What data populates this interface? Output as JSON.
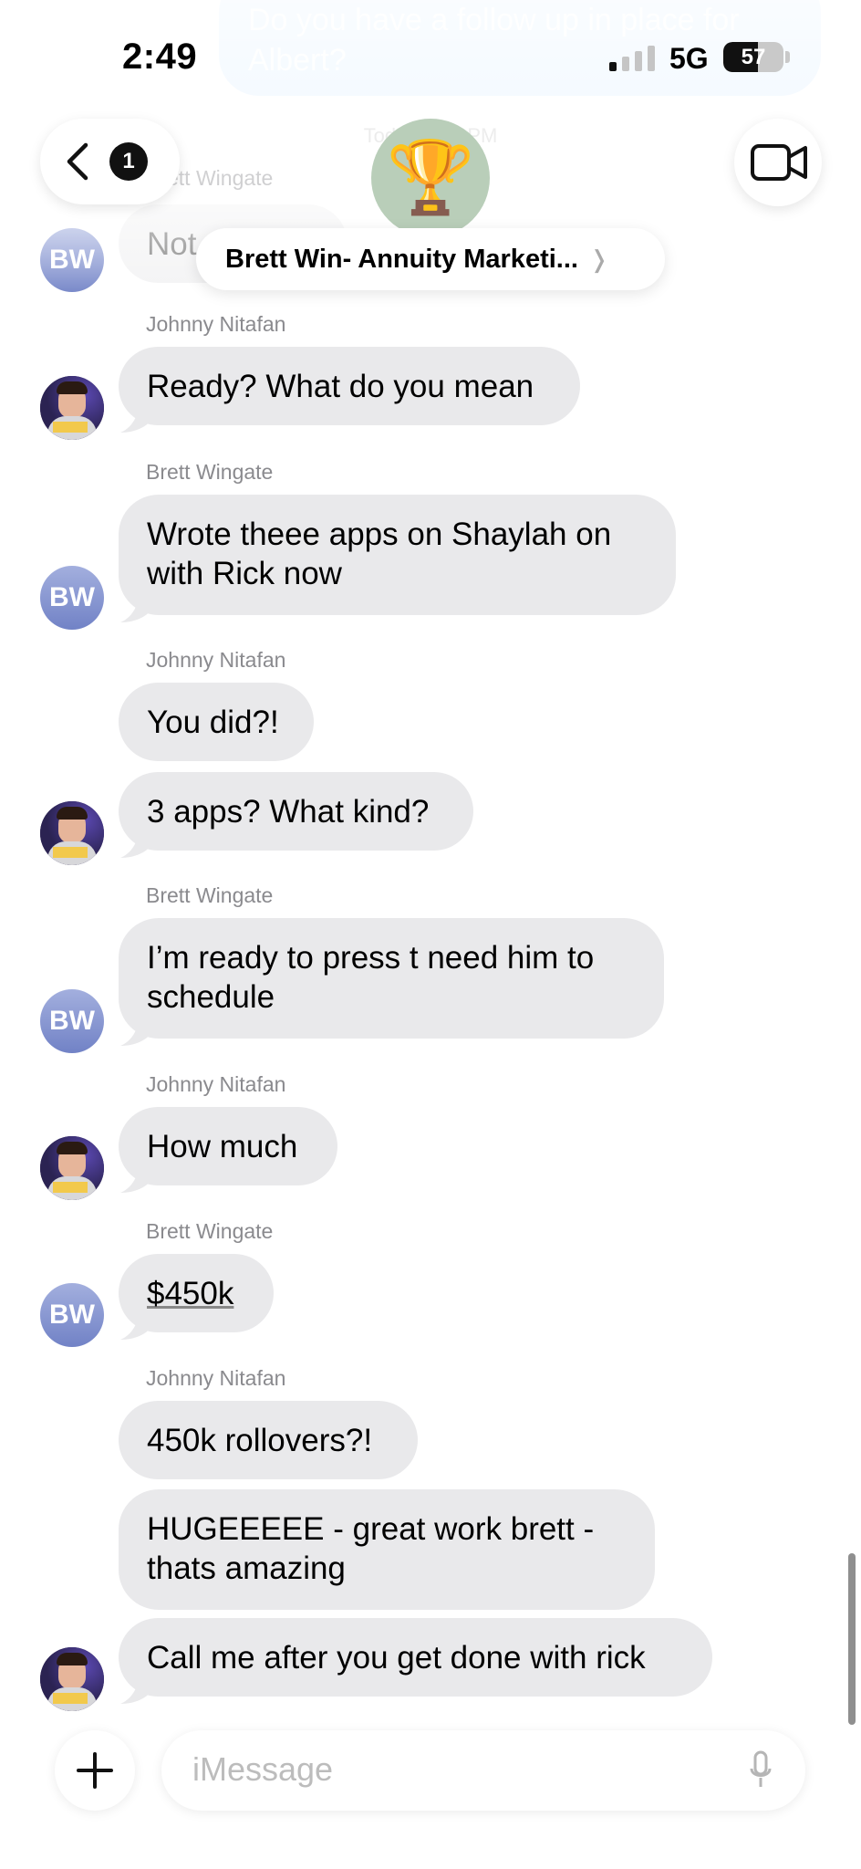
{
  "top_partial_message": {
    "text": "Do you have a follow up in place for Albert?"
  },
  "timestamp": "Today 2:47 PM",
  "status_bar": {
    "time": "2:49",
    "network": "5G",
    "battery_level": "57",
    "battery_fraction": 0.57,
    "signal_bars_active": 1
  },
  "header": {
    "back_badge": "1",
    "group_avatar_emoji": "🏆",
    "group_name": "Brett Win- Annuity Marketi...",
    "group_name_chevron": "❭"
  },
  "conversation": {
    "hidden_top": {
      "sender": "Brett Wingate",
      "text": "Not sure yet"
    },
    "blocks": [
      {
        "sender": "Johnny Nitafan",
        "avatar": "photo",
        "messages": [
          "Ready? What do you mean"
        ]
      },
      {
        "sender": "Brett Wingate",
        "avatar_initials": "BW",
        "messages": [
          "Wrote theee apps on Shaylah on with Rick now"
        ]
      },
      {
        "sender": "Johnny Nitafan",
        "avatar": "photo",
        "messages": [
          "You did?!",
          "3 apps? What kind?"
        ]
      },
      {
        "sender": "Brett Wingate",
        "avatar_initials": "BW",
        "messages": [
          "I’m ready to press t need him to schedule"
        ]
      },
      {
        "sender": "Johnny Nitafan",
        "avatar": "photo",
        "messages": [
          "How much"
        ]
      },
      {
        "sender": "Brett Wingate",
        "avatar_initials": "BW",
        "messages": [
          "$450k"
        ]
      },
      {
        "sender": "Johnny Nitafan",
        "avatar": "photo",
        "messages": [
          "450k rollovers?!",
          "HUGEEEEE - great work brett - thats amazing",
          "Call me after you get done with rick"
        ]
      }
    ]
  },
  "composer": {
    "placeholder": "iMessage",
    "plus_icon": "plus-icon",
    "mic_icon": "microphone-icon"
  },
  "colors": {
    "bubble_incoming": "#e9e9eb",
    "bubble_outgoing_faded": "#dbeefe",
    "avatar_bw": "#8a97d4"
  }
}
